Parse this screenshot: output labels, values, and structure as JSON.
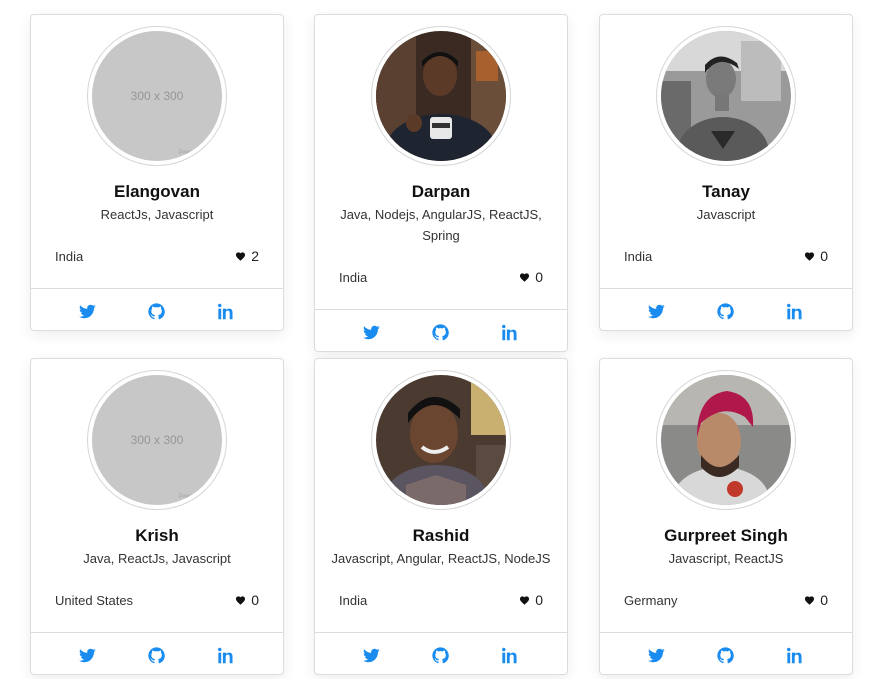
{
  "colors": {
    "link": "#1a8cf0",
    "heart": "#111111",
    "placeholder_bg": "#c7c7c7"
  },
  "cards": [
    {
      "name": "Elangovan",
      "skills": "ReactJs, Javascript",
      "country": "India",
      "likes": "2",
      "avatar": {
        "type": "placeholder",
        "text": "300 x 300",
        "subtext": "Powered by"
      }
    },
    {
      "name": "Darpan",
      "skills": "Java, Nodejs, AngularJS, ReactJS, Spring",
      "country": "India",
      "likes": "0",
      "avatar": {
        "type": "photo"
      }
    },
    {
      "name": "Tanay",
      "skills": "Javascript",
      "country": "India",
      "likes": "0",
      "avatar": {
        "type": "photo"
      }
    },
    {
      "name": "Krish",
      "skills": "Java, ReactJs, Javascript",
      "country": "United States",
      "likes": "0",
      "avatar": {
        "type": "placeholder",
        "text": "300 x 300",
        "subtext": "Powered by"
      }
    },
    {
      "name": "Rashid",
      "skills": "Javascript, Angular, ReactJS, NodeJS",
      "country": "India",
      "likes": "0",
      "avatar": {
        "type": "photo"
      }
    },
    {
      "name": "Gurpreet Singh",
      "skills": "Javascript, ReactJS",
      "country": "Germany",
      "likes": "0",
      "avatar": {
        "type": "photo"
      }
    }
  ],
  "social_icons": [
    "twitter-icon",
    "github-icon",
    "linkedin-icon"
  ],
  "like_icon": "heart-icon"
}
